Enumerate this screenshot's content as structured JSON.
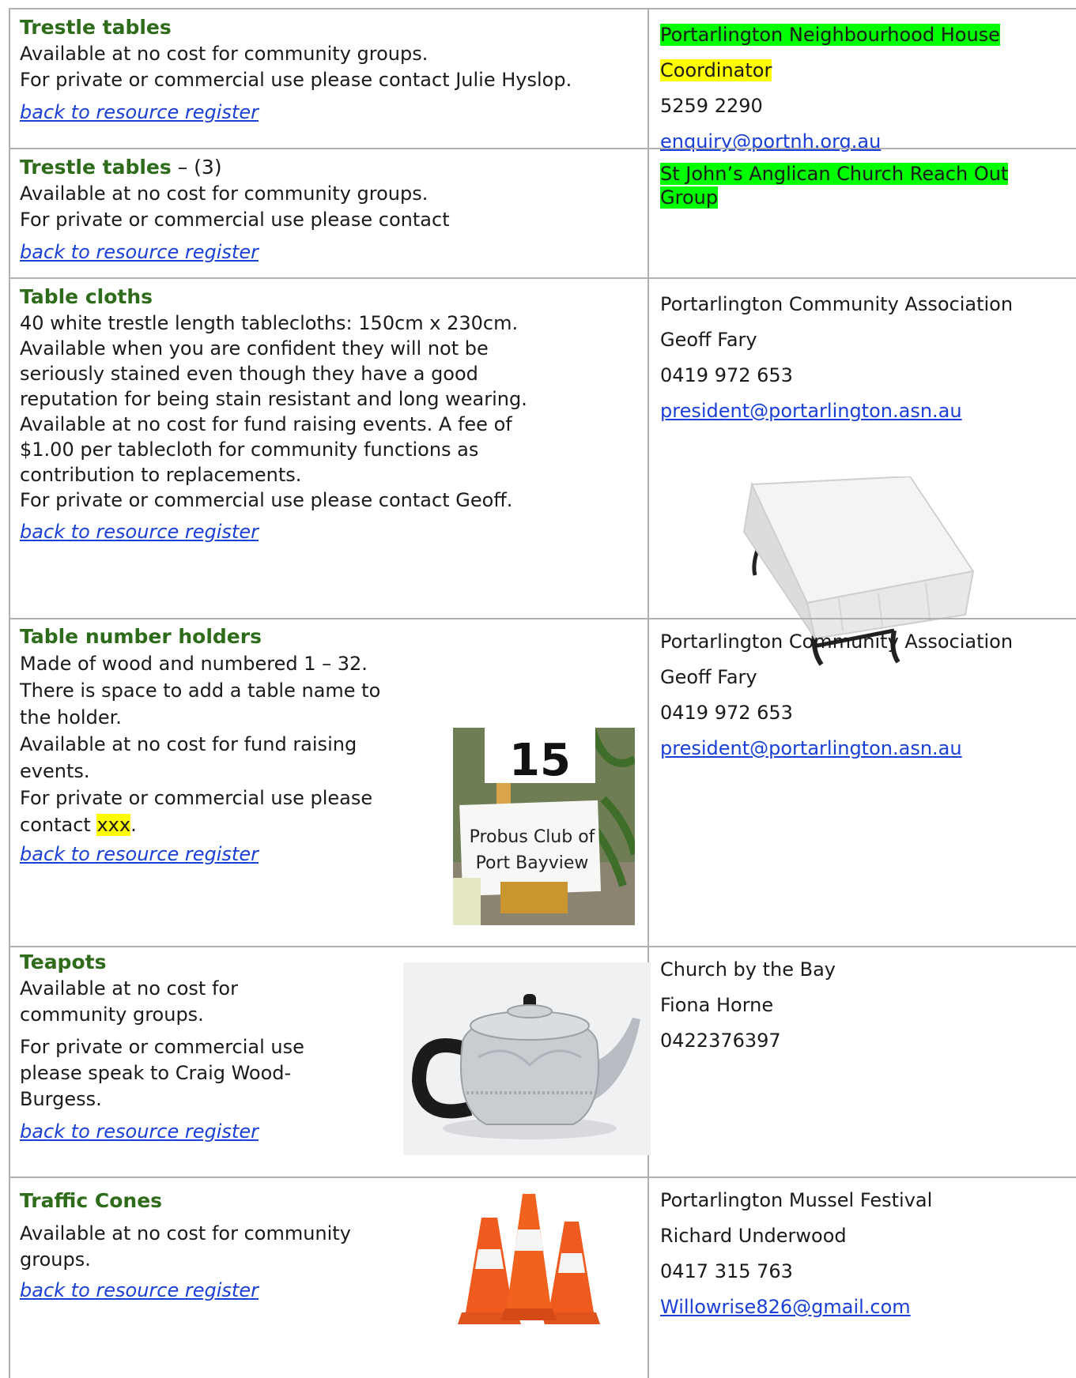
{
  "rows": [
    {
      "title": "Trestle tables",
      "lines": [
        "Available at no cost for community groups.",
        "For private or commercial use please contact Julie Hyslop."
      ],
      "back": "back to resource register",
      "org": "Portarlington Neighbourhood House",
      "role": "Coordinator",
      "phone": "5259 2290",
      "email": "enquiry@portnh.org.au"
    },
    {
      "title": "Trestle tables",
      "title_suffix": " – (3)",
      "lines": [
        "Available at no cost for community groups.",
        "For private or commercial use please contact"
      ],
      "back": "back to resource register",
      "org_line1": "St John’s Anglican Church Reach Out",
      "org_line2": "Group"
    },
    {
      "title": "Table cloths",
      "lines": [
        "40 white trestle length tablecloths: 150cm x 230cm.",
        "Available when you are confident they will not be",
        "seriously stained even though they have a good",
        "reputation for being stain resistant and long wearing.",
        "Available at no cost for fund raising events.  A fee of",
        "$1.00 per tablecloth for community functions as",
        "contribution to replacements.",
        "For private or commercial use please contact Geoff."
      ],
      "back": "back to resource register",
      "org": "Portarlington Community Association",
      "name": "Geoff Fary",
      "phone": "0419 972 653",
      "email": "president@portarlington.asn.au"
    },
    {
      "title": "Table number holders",
      "lines": [
        "Made of wood and numbered 1 – 32.",
        "There is space to add a table name to",
        "the holder.",
        "Available at no cost for fund raising",
        "events.",
        "For private or commercial use please"
      ],
      "contact_prefix": "contact ",
      "contact_highlight": "xxx",
      "contact_suffix": ".",
      "back": "back to resource register",
      "photo": {
        "number": "15",
        "sign_line1": "Probus Club of",
        "sign_line2": "Port Bayview"
      },
      "org": "Portarlington Community Association",
      "name": "Geoff Fary",
      "phone": "0419 972 653",
      "email": "president@portarlington.asn.au"
    },
    {
      "title": "Teapots",
      "lines": [
        "Available at no cost for",
        "community groups."
      ],
      "lines2": [
        "For private or commercial use",
        "please speak to Craig Wood-",
        "Burgess."
      ],
      "back": "back to resource register",
      "org": "Church by the Bay",
      "name": "Fiona Horne",
      "phone": "0422376397"
    },
    {
      "title": "Traffic Cones",
      "lines": [
        "Available at no cost for community",
        "groups."
      ],
      "back": "back to resource register",
      "org": "Portarlington Mussel Festival",
      "name": "Richard Underwood",
      "phone": "0417 315 763",
      "email": "Willowrise826@gmail.com"
    }
  ],
  "colors": {
    "title": "#2e6b1a",
    "link": "#1a3fd6",
    "highlight_green": "#00ff00",
    "highlight_yellow": "#ffff00",
    "border": "#b0b0b0"
  }
}
